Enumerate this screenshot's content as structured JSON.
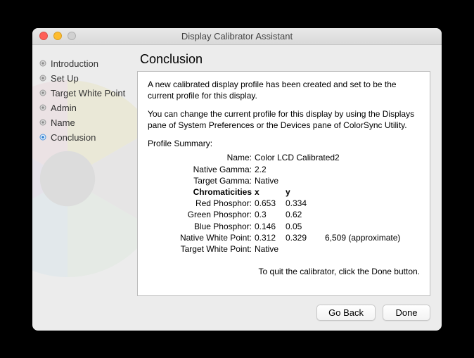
{
  "window": {
    "title": "Display Calibrator Assistant"
  },
  "sidebar": {
    "items": [
      {
        "label": "Introduction"
      },
      {
        "label": "Set Up"
      },
      {
        "label": "Target White Point"
      },
      {
        "label": "Admin"
      },
      {
        "label": "Name"
      },
      {
        "label": "Conclusion"
      }
    ]
  },
  "main": {
    "heading": "Conclusion",
    "p1": "A new calibrated display profile has been created and set to be the current profile for this display.",
    "p2": "You can change the current profile for this display by using the Displays pane of System Preferences or the Devices pane of ColorSync Utility.",
    "summary_title": "Profile Summary:",
    "rows": {
      "name_label": "Name:",
      "name_value": "Color LCD Calibrated2",
      "native_gamma_label": "Native Gamma:",
      "native_gamma_value": "2.2",
      "target_gamma_label": "Target Gamma:",
      "target_gamma_value": "Native",
      "chrom_label": "Chromaticities",
      "x_hdr": "x",
      "y_hdr": "y",
      "red_label": "Red Phosphor:",
      "red_x": "0.653",
      "red_y": "0.334",
      "green_label": "Green Phosphor:",
      "green_x": "0.3",
      "green_y": "0.62",
      "blue_label": "Blue Phosphor:",
      "blue_x": "0.146",
      "blue_y": "0.05",
      "nwp_label": "Native White Point:",
      "nwp_x": "0.312",
      "nwp_y": "0.329",
      "nwp_extra": "6,509 (approximate)",
      "twp_label": "Target White Point:",
      "twp_value": "Native"
    },
    "footer_note": "To quit the calibrator, click the Done button."
  },
  "buttons": {
    "back": "Go Back",
    "done": "Done"
  }
}
